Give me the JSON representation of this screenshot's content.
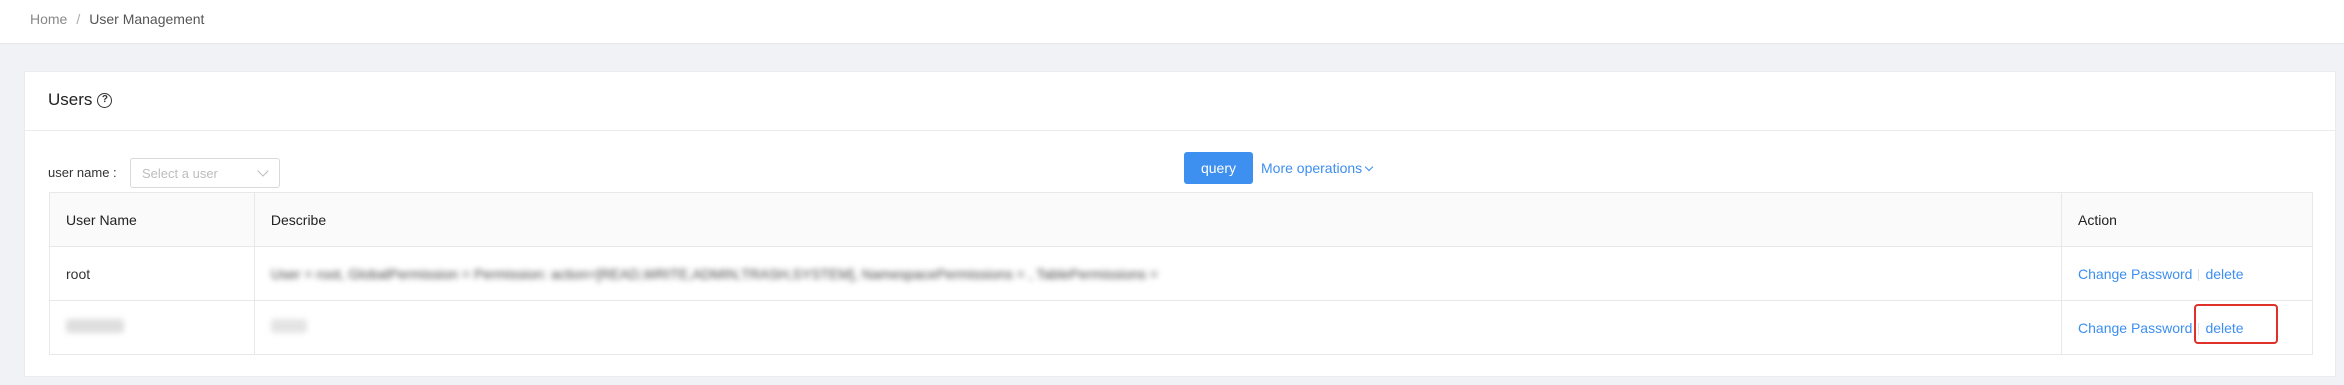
{
  "breadcrumb": {
    "home": "Home",
    "separator": "/",
    "current": "User Management"
  },
  "card": {
    "title": "Users",
    "help_icon": "?"
  },
  "filter": {
    "label": "user name :",
    "select_placeholder": "Select a user",
    "query_label": "query",
    "more_label": "More operations"
  },
  "table": {
    "headers": {
      "name": "User Name",
      "describe": "Describe",
      "action": "Action"
    },
    "rows": [
      {
        "name": "root",
        "describe": "User = root, GlobalPermission = Permission: action=[READ,WRITE,ADMIN,TRASH,SYSTEM], NamespacePermissions = , TablePermissions =",
        "change_password": "Change Password",
        "delete": "delete"
      },
      {
        "name": "",
        "describe": "",
        "change_password": "Change Password",
        "delete": "delete"
      }
    ]
  },
  "colors": {
    "primary": "#3d8ff0",
    "highlight": "#e0302a"
  }
}
